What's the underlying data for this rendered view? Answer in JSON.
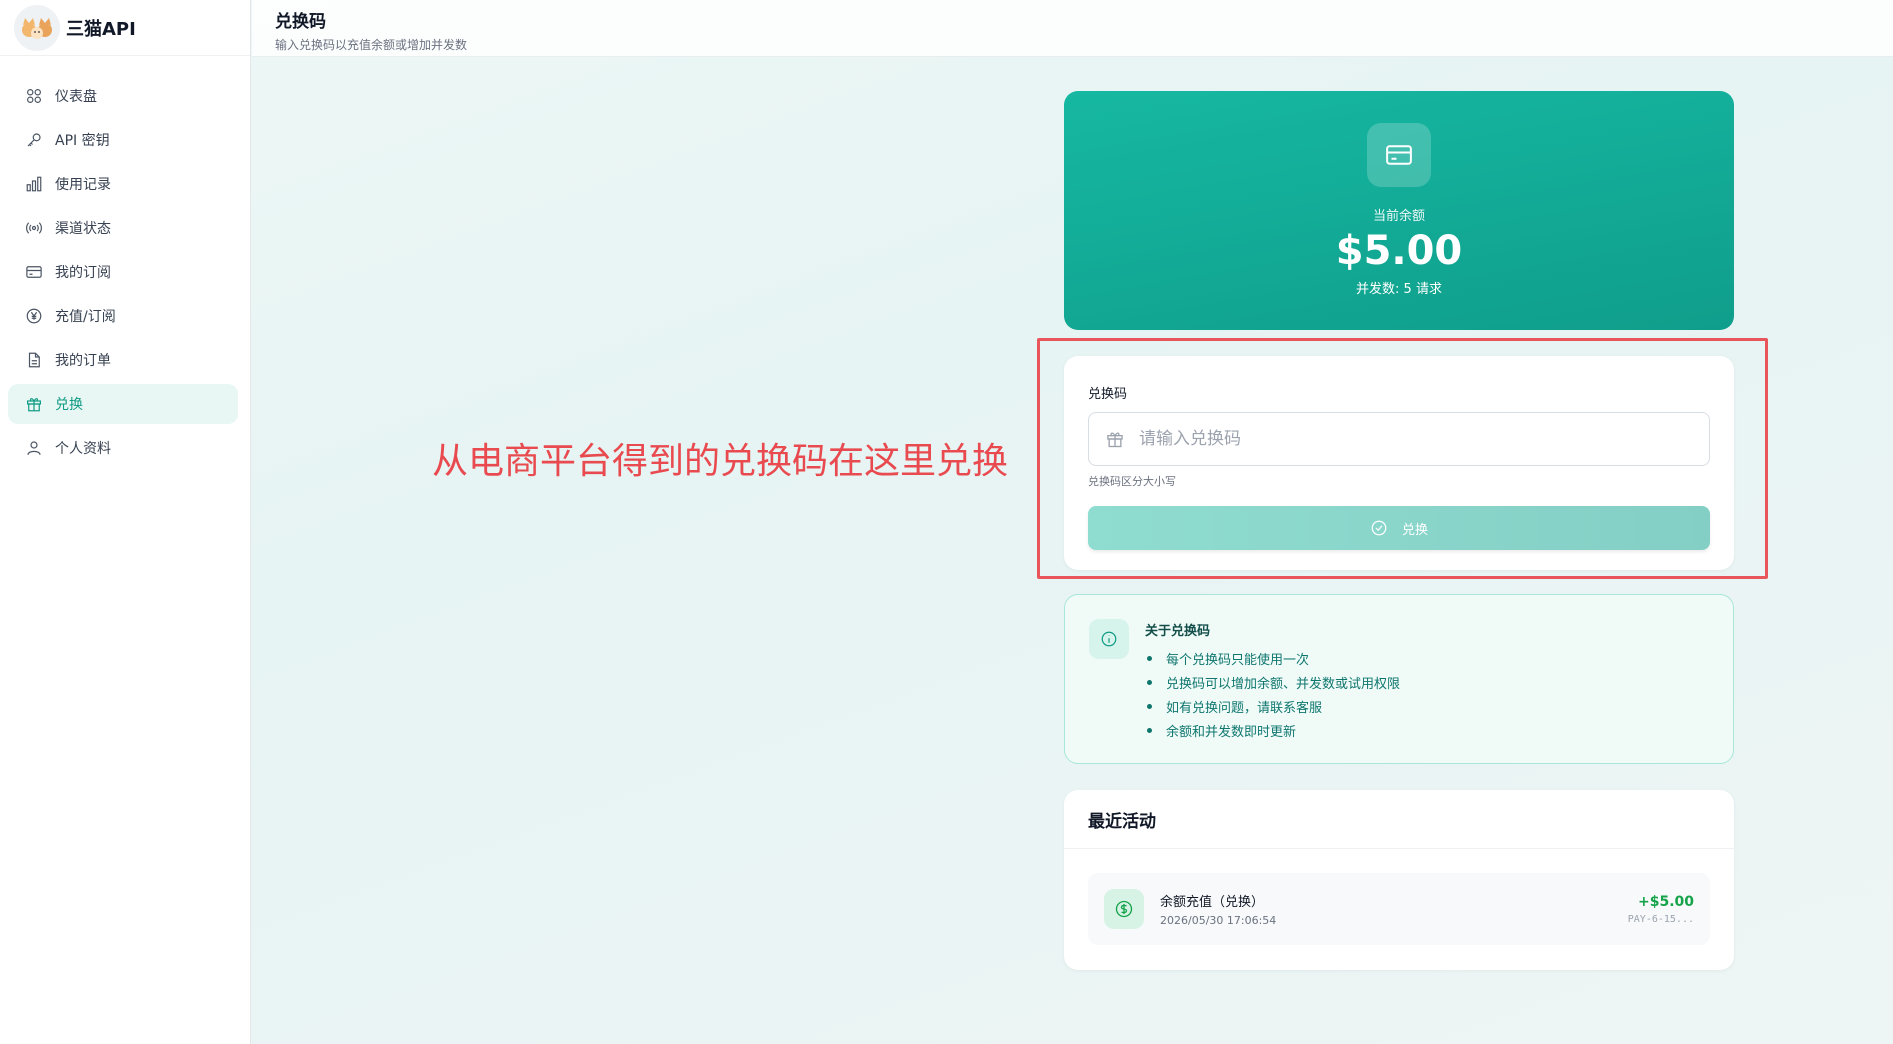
{
  "brand": {
    "name": "三猫API"
  },
  "sidebar": {
    "items": [
      {
        "label": "仪表盘",
        "icon": "dashboard-icon"
      },
      {
        "label": "API 密钥",
        "icon": "key-icon"
      },
      {
        "label": "使用记录",
        "icon": "bar-chart-icon"
      },
      {
        "label": "渠道状态",
        "icon": "broadcast-icon"
      },
      {
        "label": "我的订阅",
        "icon": "credit-card-icon"
      },
      {
        "label": "充值/订阅",
        "icon": "yen-icon"
      },
      {
        "label": "我的订单",
        "icon": "document-icon"
      },
      {
        "label": "兑换",
        "icon": "gift-icon",
        "active": true
      },
      {
        "label": "个人资料",
        "icon": "user-icon"
      }
    ]
  },
  "header": {
    "title": "兑换码",
    "subtitle": "输入兑换码以充值余额或增加并发数"
  },
  "balance": {
    "label": "当前余额",
    "amount": "$5.00",
    "concurrency": "并发数: 5 请求"
  },
  "redeem": {
    "field_label": "兑换码",
    "placeholder": "请输入兑换码",
    "value": "",
    "hint": "兑换码区分大小写",
    "button_label": "兑换"
  },
  "annotation": {
    "text": "从电商平台得到的兑换码在这里兑换",
    "color": "#e84a4f"
  },
  "info": {
    "title": "关于兑换码",
    "items": [
      "每个兑换码只能使用一次",
      "兑换码可以增加余额、并发数或试用权限",
      "如有兑换问题，请联系客服",
      "余额和并发数即时更新"
    ]
  },
  "recent": {
    "title": "最近活动",
    "items": [
      {
        "name": "余额充值（兑换）",
        "time": "2026/05/30 17:06:54",
        "amount": "+$5.00",
        "ref": "PAY-6-15..."
      }
    ]
  },
  "colors": {
    "accent": "#0f9b84",
    "balance_gradient_start": "#16b8a2",
    "balance_gradient_end": "#0f9e8b",
    "annotation": "#e8555a",
    "success": "#16a34a"
  }
}
